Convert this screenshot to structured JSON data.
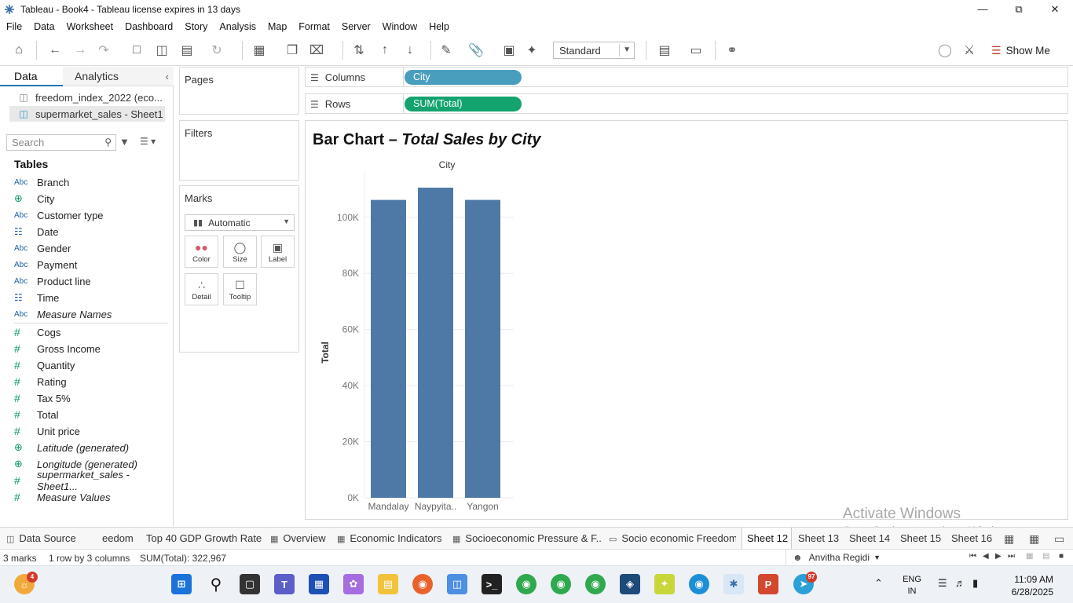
{
  "window": {
    "title": "Tableau - Book4 - Tableau license expires in 13 days"
  },
  "menu": [
    "File",
    "Data",
    "Worksheet",
    "Dashboard",
    "Story",
    "Analysis",
    "Map",
    "Format",
    "Server",
    "Window",
    "Help"
  ],
  "toolbar": {
    "fit_select": "Standard",
    "show_me": "Show Me"
  },
  "data_pane": {
    "tab_data": "Data",
    "tab_analytics": "Analytics",
    "data_sources": [
      "freedom_index_2022 (eco...",
      "supermarket_sales - Sheet1"
    ],
    "search_placeholder": "Search",
    "tables_heading": "Tables",
    "dimensions": [
      {
        "type": "Abc",
        "name": "Branch"
      },
      {
        "type": "geo",
        "name": "City"
      },
      {
        "type": "Abc",
        "name": "Customer type"
      },
      {
        "type": "date",
        "name": "Date"
      },
      {
        "type": "Abc",
        "name": "Gender"
      },
      {
        "type": "Abc",
        "name": "Payment"
      },
      {
        "type": "Abc",
        "name": "Product line"
      },
      {
        "type": "date",
        "name": "Time"
      },
      {
        "type": "Abc",
        "name": "Measure Names"
      }
    ],
    "measures": [
      {
        "type": "#",
        "name": "Cogs"
      },
      {
        "type": "#",
        "name": "Gross Income"
      },
      {
        "type": "#",
        "name": "Quantity"
      },
      {
        "type": "#",
        "name": "Rating"
      },
      {
        "type": "#",
        "name": "Tax 5%"
      },
      {
        "type": "#",
        "name": "Total"
      },
      {
        "type": "#",
        "name": "Unit price"
      },
      {
        "type": "geo",
        "name": "Latitude (generated)"
      },
      {
        "type": "geo",
        "name": "Longitude (generated)"
      },
      {
        "type": "#",
        "name": "supermarket_sales - Sheet1..."
      },
      {
        "type": "#",
        "name": "Measure Values"
      }
    ]
  },
  "cards": {
    "pages": "Pages",
    "filters": "Filters",
    "marks": "Marks",
    "marks_type": "Automatic",
    "mark_buttons": [
      "Color",
      "Size",
      "Label",
      "Detail",
      "Tooltip"
    ]
  },
  "shelves": {
    "columns_label": "Columns",
    "columns_pill": "City",
    "rows_label": "Rows",
    "rows_pill": "SUM(Total)"
  },
  "viz": {
    "title_plain": "Bar Chart – ",
    "title_italic": "Total Sales by City"
  },
  "chart_data": {
    "type": "bar",
    "title": "Bar Chart – Total Sales by City",
    "xlabel": "City",
    "ylabel": "Total",
    "categories": [
      "Mandalay",
      "Naypyita..",
      "Yangon"
    ],
    "values": [
      106198,
      110569,
      106201
    ],
    "ylim": [
      0,
      110569
    ],
    "yticks": [
      0,
      20000,
      40000,
      60000,
      80000,
      100000
    ],
    "ytick_labels": [
      "0K",
      "20K",
      "40K",
      "60K",
      "80K",
      "100K"
    ],
    "bar_color": "#4e79a7",
    "grid": true
  },
  "watermark": {
    "line1": "Activate Windows",
    "line2": "Go to Settings to activate Windows."
  },
  "sheet_tabs": [
    {
      "label": "Data Source",
      "kind": "datasource"
    },
    {
      "label": "eedom",
      "kind": "sheet"
    },
    {
      "label": "Top 40 GDP Growth Rate",
      "kind": "sheet"
    },
    {
      "label": "Overview",
      "kind": "dashboard"
    },
    {
      "label": "Economic Indicators",
      "kind": "dashboard"
    },
    {
      "label": "Socioeconomic Pressure & F...",
      "kind": "dashboard"
    },
    {
      "label": "Socio economic Freedom",
      "kind": "story"
    },
    {
      "label": "Sheet 12",
      "kind": "active"
    },
    {
      "label": "Sheet 13",
      "kind": "sheet"
    },
    {
      "label": "Sheet 14",
      "kind": "sheet"
    },
    {
      "label": "Sheet 15",
      "kind": "sheet"
    },
    {
      "label": "Sheet 16",
      "kind": "sheet"
    }
  ],
  "status": {
    "marks": "3 marks",
    "dims": "1 row by 3 columns",
    "sum": "SUM(Total): 322,967",
    "user": "Anvitha  Regidi"
  },
  "taskbar": {
    "weather_badge": "4",
    "telegram_badge": "97",
    "lang_line1": "ENG",
    "lang_line2": "IN",
    "time": "11:09 AM",
    "date": "6/28/2025"
  }
}
